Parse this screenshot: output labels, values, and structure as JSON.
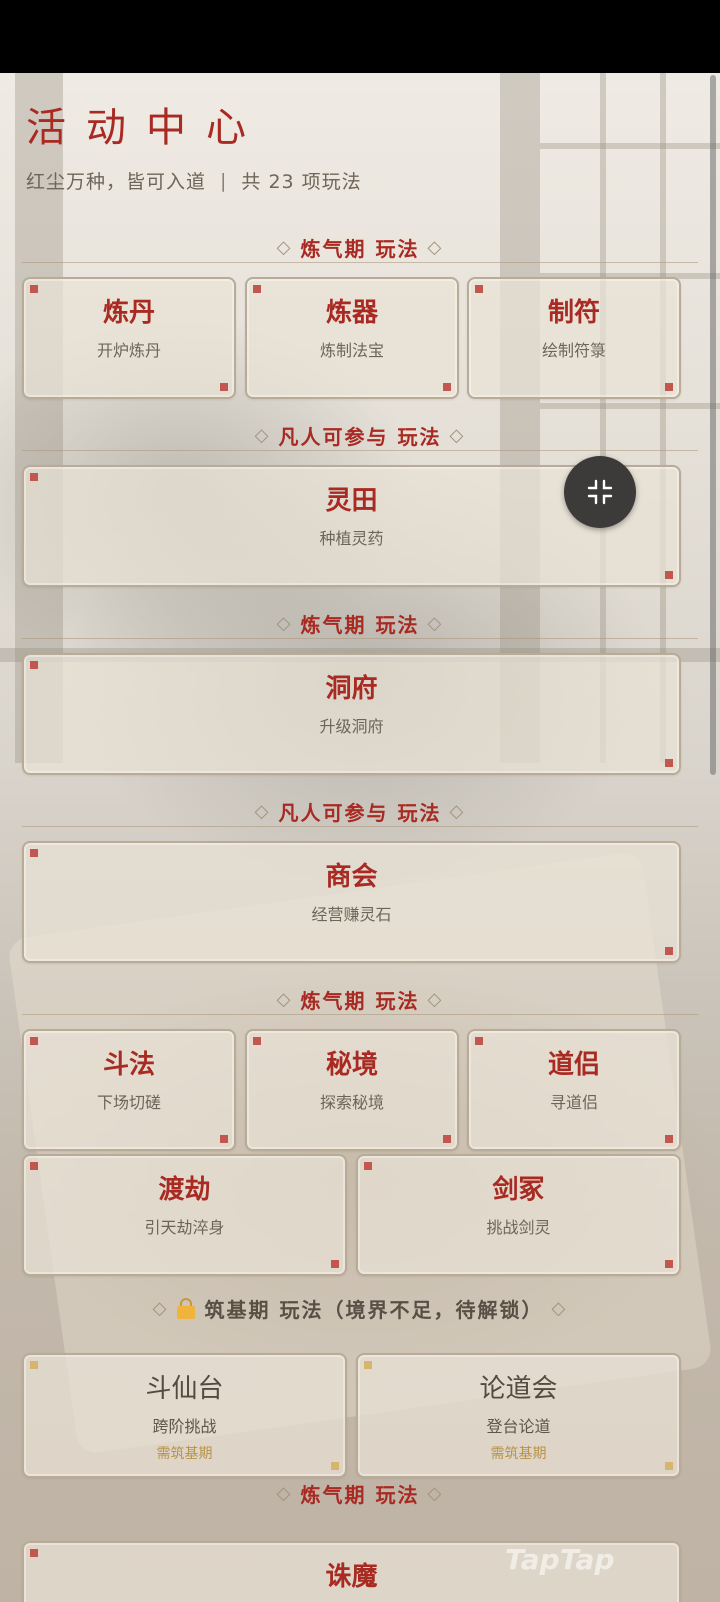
{
  "header": {
    "title": "活动中心",
    "subtitle_left": "红尘万种，皆可入道",
    "separator": "|",
    "subtitle_right": "共 23 项玩法"
  },
  "sections": [
    {
      "label": "炼气期 玩法"
    },
    {
      "label": "凡人可参与 玩法"
    },
    {
      "label": "炼气期 玩法"
    },
    {
      "label": "凡人可参与 玩法"
    },
    {
      "label": "炼气期 玩法"
    },
    {
      "label": "筑基期 玩法（境界不足，待解锁）"
    },
    {
      "label": "炼气期 玩法"
    }
  ],
  "diamond": "◇",
  "cards": [
    {
      "name": "炼丹",
      "desc": "开炉炼丹"
    },
    {
      "name": "炼器",
      "desc": "炼制法宝"
    },
    {
      "name": "制符",
      "desc": "绘制符箓"
    },
    {
      "name": "灵田",
      "desc": "种植灵药"
    },
    {
      "name": "洞府",
      "desc": "升级洞府"
    },
    {
      "name": "商会",
      "desc": "经营赚灵石"
    },
    {
      "name": "斗法",
      "desc": "下场切磋"
    },
    {
      "name": "秘境",
      "desc": "探索秘境"
    },
    {
      "name": "道侣",
      "desc": "寻道侣"
    },
    {
      "name": "渡劫",
      "desc": "引天劫淬身"
    },
    {
      "name": "剑冢",
      "desc": "挑战剑灵"
    },
    {
      "name": "斗仙台",
      "desc": "跨阶挑战",
      "requirement": "需筑基期"
    },
    {
      "name": "论道会",
      "desc": "登台论道",
      "requirement": "需筑基期"
    },
    {
      "name": "诛魔",
      "desc": ""
    }
  ],
  "colors": {
    "accent_red": "#a82a22",
    "lock_gold": "#f0b43c",
    "requirement_gold": "#b89248"
  },
  "floating_button": {
    "icon": "collapse-icon"
  },
  "watermark": "TapTap"
}
